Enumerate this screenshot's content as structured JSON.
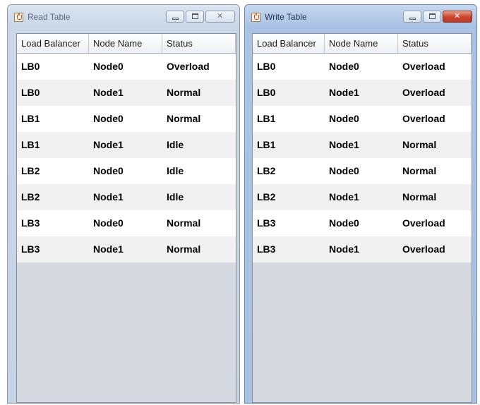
{
  "windows": {
    "read": {
      "title": "Read Table",
      "columns": [
        "Load Balancer",
        "Node Name",
        "Status"
      ],
      "rows": [
        [
          "LB0",
          "Node0",
          "Overload"
        ],
        [
          "LB0",
          "Node1",
          "Normal"
        ],
        [
          "LB1",
          "Node0",
          "Normal"
        ],
        [
          "LB1",
          "Node1",
          "Idle"
        ],
        [
          "LB2",
          "Node0",
          "Idle"
        ],
        [
          "LB2",
          "Node1",
          "Idle"
        ],
        [
          "LB3",
          "Node0",
          "Normal"
        ],
        [
          "LB3",
          "Node1",
          "Normal"
        ]
      ]
    },
    "write": {
      "title": "Write Table",
      "columns": [
        "Load Balancer",
        "Node Name",
        "Status"
      ],
      "rows": [
        [
          "LB0",
          "Node0",
          "Overload"
        ],
        [
          "LB0",
          "Node1",
          "Overload"
        ],
        [
          "LB1",
          "Node0",
          "Overload"
        ],
        [
          "LB1",
          "Node1",
          "Normal"
        ],
        [
          "LB2",
          "Node0",
          "Normal"
        ],
        [
          "LB2",
          "Node1",
          "Normal"
        ],
        [
          "LB3",
          "Node0",
          "Overload"
        ],
        [
          "LB3",
          "Node1",
          "Overload"
        ]
      ]
    }
  },
  "icons": {
    "app": "java-app-icon",
    "minimize": "minimize-icon",
    "maximize": "maximize-icon",
    "close": "close-icon"
  },
  "colors": {
    "active_close_button": "#c8432a",
    "row_alt": "#f1f1f1",
    "empty_area": "#d6d9df"
  }
}
